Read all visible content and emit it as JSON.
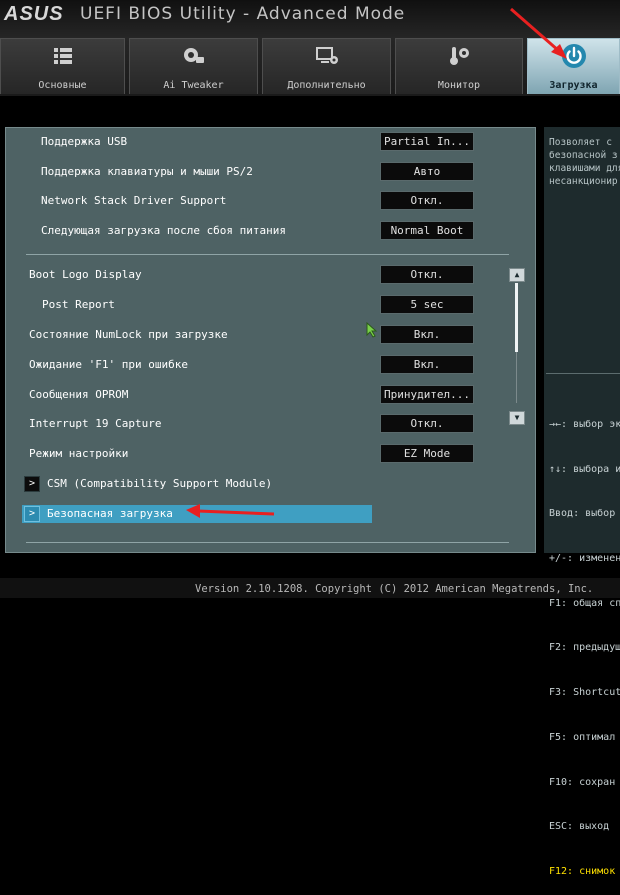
{
  "header": {
    "logo": "ASUS",
    "title": "UEFI BIOS Utility - Advanced Mode",
    "tabs": [
      {
        "label": "Основные",
        "icon": "list-icon"
      },
      {
        "label": "Ai Tweaker",
        "icon": "cpu-fan-icon"
      },
      {
        "label": "Дополнительно",
        "icon": "settings-monitor-icon"
      },
      {
        "label": "Монитор",
        "icon": "thermometer-fan-icon"
      },
      {
        "label": "Загрузка",
        "icon": "power-icon",
        "active": true
      }
    ]
  },
  "settings": [
    {
      "label": "Поддержка USB",
      "value": "Partial In..."
    },
    {
      "label": "Поддержка клавиатуры и мыши PS/2",
      "value": "Авто"
    },
    {
      "label": "Network Stack Driver Support",
      "value": "Откл."
    },
    {
      "label": "Следующая загрузка после сбоя питания",
      "value": "Normal Boot"
    },
    {
      "label": "Boot Logo Display",
      "value": "Откл."
    },
    {
      "label": "Post Report",
      "value": "5 sec"
    },
    {
      "label": "Состояние NumLock при загрузке",
      "value": "Вкл."
    },
    {
      "label": "Ожидание 'F1' при ошибке",
      "value": "Вкл."
    },
    {
      "label": "Сообщения OPROM",
      "value": "Принудител..."
    },
    {
      "label": "Interrupt 19 Capture",
      "value": "Откл."
    },
    {
      "label": "Режим настройки",
      "value": "EZ Mode"
    }
  ],
  "submenus": [
    {
      "label": "CSM (Compatibility Support Module)"
    },
    {
      "label": "Безопасная загрузка",
      "selected": true
    }
  ],
  "help_text": "Позволяет с\nбезопасной з\nклавишами для\nнесанкционир",
  "keys": [
    {
      "text": "→←: выбор эк"
    },
    {
      "text": "↑↓: выбора и"
    },
    {
      "text": "Ввод: выбор"
    },
    {
      "text": "+/-: изменен"
    },
    {
      "text": "F1: общая сп"
    },
    {
      "text": "F2: предыдущ"
    },
    {
      "text": "F3: Shortcut"
    },
    {
      "text": "F5: оптимал"
    },
    {
      "text": "F10: сохран"
    },
    {
      "text": "ESC: выход"
    },
    {
      "text": "F12: снимок",
      "highlight": true
    }
  ],
  "footer": {
    "version": "Version 2.10.1208. Copyright (C) 2012 American Megatrends, Inc."
  },
  "colors": {
    "accent": "#3f9fc2",
    "panel": "#4e6264",
    "annotation": "#e82020",
    "key_highlight": "#ffe100"
  }
}
